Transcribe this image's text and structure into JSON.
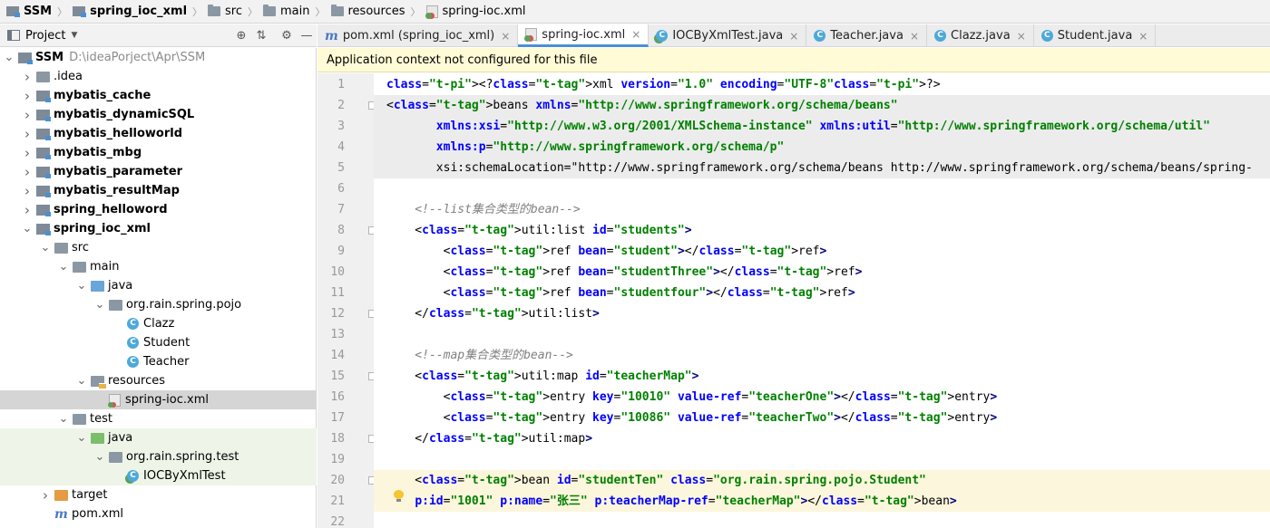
{
  "breadcrumbs": [
    "SSM",
    "spring_ioc_xml",
    "src",
    "main",
    "resources",
    "spring-ioc.xml"
  ],
  "project_panel": {
    "title": "Project",
    "tree": [
      {
        "label": "SSM",
        "path": "D:\\ideaPorject\\Apr\\SSM",
        "depth": 0,
        "icon": "module-folder-icon",
        "bold": true,
        "expanded": true
      },
      {
        "label": ".idea",
        "depth": 1,
        "icon": "folder-icon",
        "expanded": false
      },
      {
        "label": "mybatis_cache",
        "depth": 1,
        "icon": "module-folder-icon",
        "bold": true,
        "expanded": false
      },
      {
        "label": "mybatis_dynamicSQL",
        "depth": 1,
        "icon": "module-folder-icon",
        "bold": true,
        "expanded": false
      },
      {
        "label": "mybatis_helloworld",
        "depth": 1,
        "icon": "module-folder-icon",
        "bold": true,
        "expanded": false
      },
      {
        "label": "mybatis_mbg",
        "depth": 1,
        "icon": "module-folder-icon",
        "bold": true,
        "expanded": false
      },
      {
        "label": "mybatis_parameter",
        "depth": 1,
        "icon": "module-folder-icon",
        "bold": true,
        "expanded": false
      },
      {
        "label": "mybatis_resultMap",
        "depth": 1,
        "icon": "module-folder-icon",
        "bold": true,
        "expanded": false
      },
      {
        "label": "spring_helloword",
        "depth": 1,
        "icon": "module-folder-icon",
        "bold": true,
        "expanded": false
      },
      {
        "label": "spring_ioc_xml",
        "depth": 1,
        "icon": "module-folder-icon",
        "bold": true,
        "expanded": true
      },
      {
        "label": "src",
        "depth": 2,
        "icon": "folder-icon",
        "expanded": true
      },
      {
        "label": "main",
        "depth": 3,
        "icon": "folder-icon",
        "expanded": true
      },
      {
        "label": "java",
        "depth": 4,
        "icon": "source-folder-icon",
        "expanded": true
      },
      {
        "label": "org.rain.spring.pojo",
        "depth": 5,
        "icon": "package-icon",
        "expanded": true
      },
      {
        "label": "Clazz",
        "depth": 6,
        "icon": "class-icon"
      },
      {
        "label": "Student",
        "depth": 6,
        "icon": "class-icon"
      },
      {
        "label": "Teacher",
        "depth": 6,
        "icon": "class-icon"
      },
      {
        "label": "resources",
        "depth": 4,
        "icon": "resources-folder-icon",
        "expanded": true
      },
      {
        "label": "spring-ioc.xml",
        "depth": 5,
        "icon": "spring-xml-icon",
        "selected": true
      },
      {
        "label": "test",
        "depth": 3,
        "icon": "folder-icon",
        "expanded": true
      },
      {
        "label": "java",
        "depth": 4,
        "icon": "test-source-folder-icon",
        "expanded": true,
        "test": true
      },
      {
        "label": "org.rain.spring.test",
        "depth": 5,
        "icon": "package-icon",
        "expanded": true,
        "test": true
      },
      {
        "label": "IOCByXmlTest",
        "depth": 6,
        "icon": "test-class-icon",
        "test": true
      },
      {
        "label": "target",
        "depth": 2,
        "icon": "excluded-folder-icon",
        "expanded": false
      },
      {
        "label": "pom.xml",
        "depth": 2,
        "icon": "maven-icon"
      }
    ]
  },
  "tabs": [
    {
      "label": "pom.xml (spring_ioc_xml)",
      "icon": "maven-icon",
      "active": false
    },
    {
      "label": "spring-ioc.xml",
      "icon": "spring-xml-icon",
      "active": true
    },
    {
      "label": "IOCByXmlTest.java",
      "icon": "test-class-icon",
      "active": false
    },
    {
      "label": "Teacher.java",
      "icon": "class-icon",
      "active": false
    },
    {
      "label": "Clazz.java",
      "icon": "class-icon",
      "active": false
    },
    {
      "label": "Student.java",
      "icon": "class-icon",
      "active": false
    }
  ],
  "banner": "Application context not configured for this file",
  "editor": {
    "lines": [
      {
        "n": "1",
        "text": "<?xml version=\"1.0\" encoding=\"UTF-8\"?>"
      },
      {
        "n": "2",
        "text": "<beans xmlns=\"http://www.springframework.org/schema/beans\""
      },
      {
        "n": "3",
        "text": "       xmlns:xsi=\"http://www.w3.org/2001/XMLSchema-instance\" xmlns:util=\"http://www.springframework.org/schema/util\""
      },
      {
        "n": "4",
        "text": "       xmlns:p=\"http://www.springframework.org/schema/p\""
      },
      {
        "n": "5",
        "text": "       xsi:schemaLocation=\"http://www.springframework.org/schema/beans http://www.springframework.org/schema/beans/spring-"
      },
      {
        "n": "6",
        "text": ""
      },
      {
        "n": "7",
        "text": "    <!--list集合类型的bean-->"
      },
      {
        "n": "8",
        "text": "    <util:list id=\"students\">"
      },
      {
        "n": "9",
        "text": "        <ref bean=\"student\"></ref>"
      },
      {
        "n": "10",
        "text": "        <ref bean=\"studentThree\"></ref>"
      },
      {
        "n": "11",
        "text": "        <ref bean=\"studentfour\"></ref>"
      },
      {
        "n": "12",
        "text": "    </util:list>"
      },
      {
        "n": "13",
        "text": ""
      },
      {
        "n": "14",
        "text": "    <!--map集合类型的bean-->"
      },
      {
        "n": "15",
        "text": "    <util:map id=\"teacherMap\">"
      },
      {
        "n": "16",
        "text": "        <entry key=\"10010\" value-ref=\"teacherOne\"></entry>"
      },
      {
        "n": "17",
        "text": "        <entry key=\"10086\" value-ref=\"teacherTwo\"></entry>"
      },
      {
        "n": "18",
        "text": "    </util:map>"
      },
      {
        "n": "19",
        "text": ""
      },
      {
        "n": "20",
        "text": "    <bean id=\"studentTen\" class=\"org.rain.spring.pojo.Student\""
      },
      {
        "n": "21",
        "text": "    p:id=\"1001\" p:name=\"张三\" p:teacherMap-ref=\"teacherMap\"></bean>"
      },
      {
        "n": "22",
        "text": ""
      }
    ]
  },
  "colors": {
    "tag": "#000080",
    "attr": "#0000ff",
    "value": "#008000",
    "comment": "#808080",
    "accent": "#4a8fd4"
  }
}
